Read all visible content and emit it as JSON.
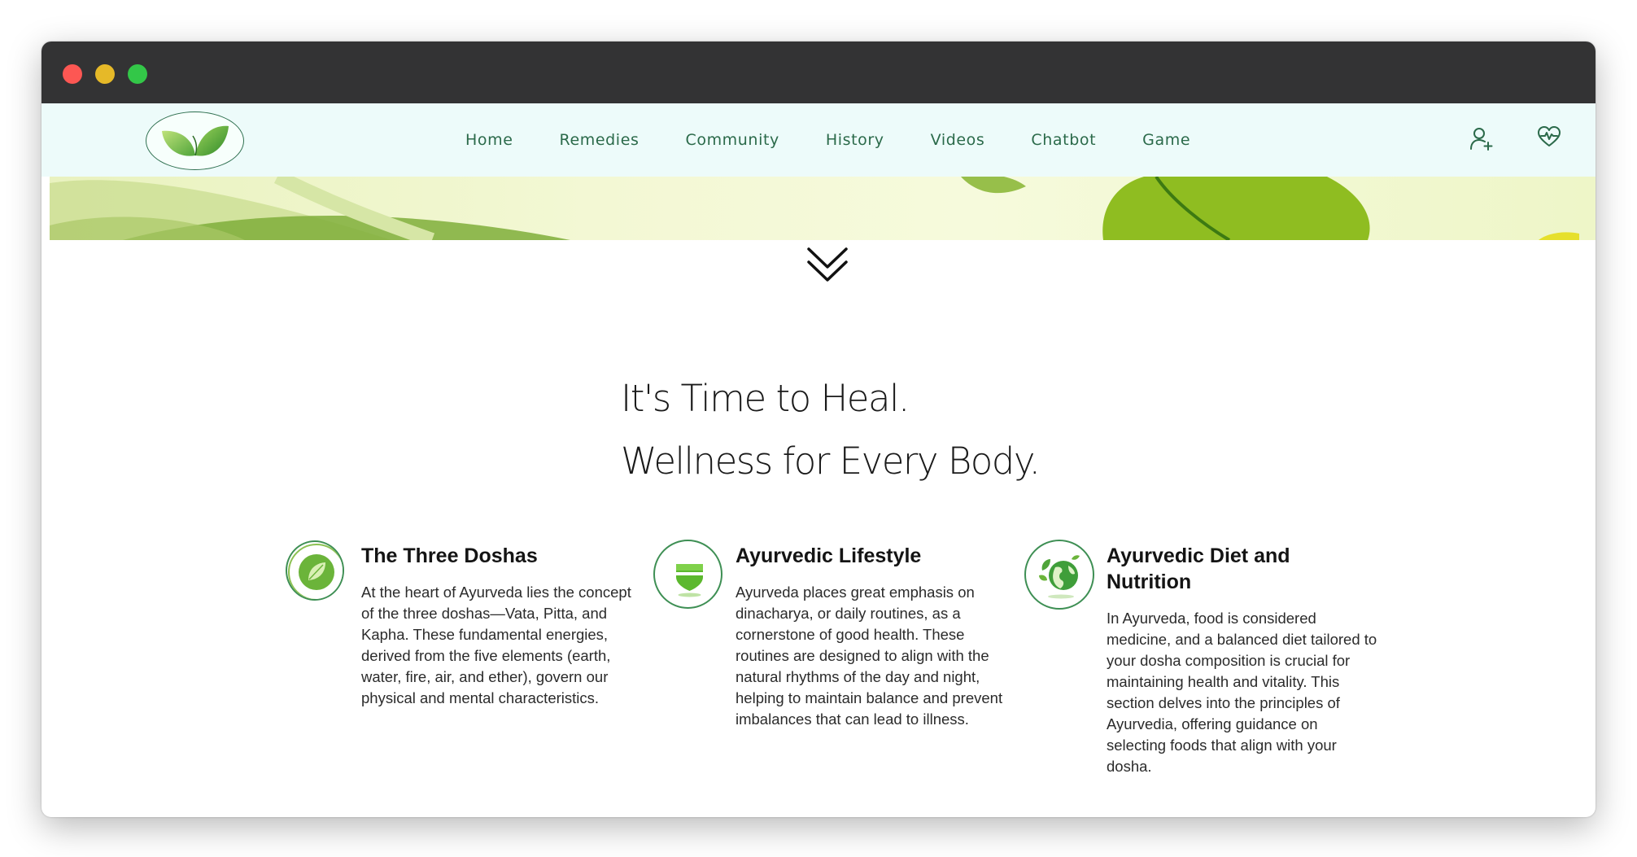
{
  "nav": {
    "links": [
      "Home",
      "Remedies",
      "Community",
      "History",
      "Videos",
      "Chatbot",
      "Game"
    ],
    "icons": [
      "user-plus-icon",
      "heart-pulse-icon"
    ]
  },
  "headline": {
    "line1": "It's Time to Heal.",
    "line2": "Wellness for Every Body."
  },
  "features": [
    {
      "icon": "leaf-icon",
      "title": "The Three Doshas",
      "text": "At the heart of Ayurveda lies the concept of the three doshas—Vata, Pitta, and Kapha. These fundamental energies, derived from the five elements (earth, water, fire, air, and ether), govern our physical and mental characteristics."
    },
    {
      "icon": "shield-icon",
      "title": "Ayurvedic Lifestyle",
      "text": "Ayurveda places great emphasis on dinacharya, or daily routines, as a cornerstone of good health. These routines are designed to align with the natural rhythms of the day and night, helping to maintain balance and prevent imbalances that can lead to illness."
    },
    {
      "icon": "green-globe-icon",
      "title": "Ayurvedic Diet and Nutrition",
      "text": "In Ayurveda, food is considered medicine, and a balanced diet tailored to your dosha composition is crucial for maintaining health and vitality. This section delves into the principles of Ayurvedia, offering guidance on selecting foods that align with your dosha."
    }
  ],
  "colors": {
    "nav_bg": "#edfbfa",
    "nav_text": "#2b6a4a",
    "accent_green": "#3e8f54",
    "titlebar": "#333334"
  }
}
